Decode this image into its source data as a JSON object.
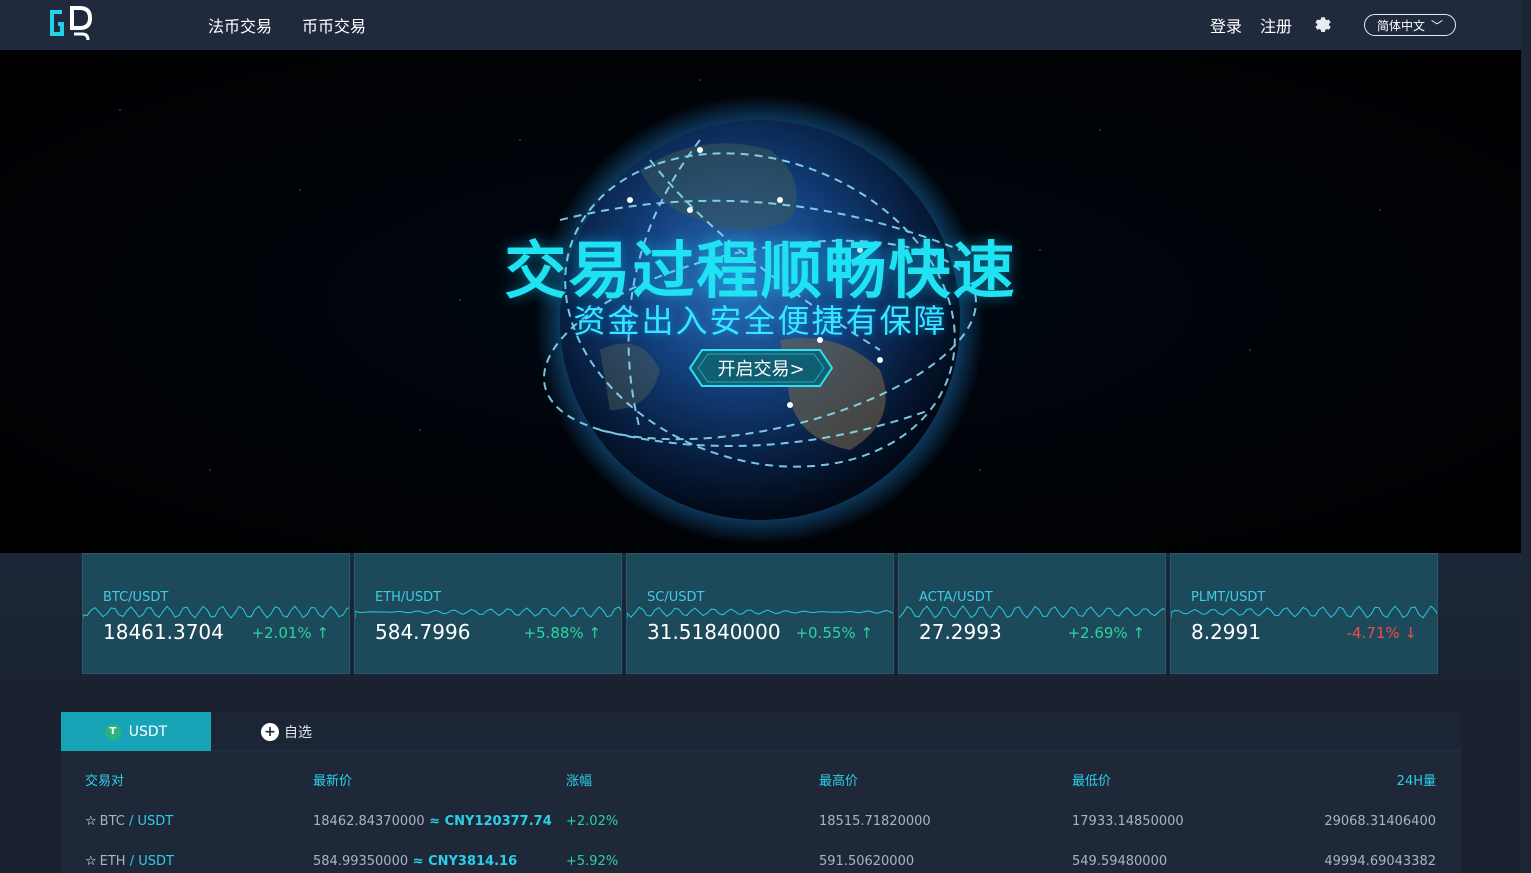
{
  "nav": {
    "logo_text": "GD",
    "links": [
      "法币交易",
      "币币交易"
    ],
    "login": "登录",
    "register": "注册",
    "language": "简体中文"
  },
  "hero": {
    "title": "交易过程顺畅快速",
    "subtitle": "资金出入安全便捷有保障",
    "button": "开启交易>"
  },
  "tickers": [
    {
      "pair": "BTC/USDT",
      "price": "18461.3704",
      "change": "+2.01% ↑",
      "direction": "up"
    },
    {
      "pair": "ETH/USDT",
      "price": "584.7996",
      "change": "+5.88% ↑",
      "direction": "up"
    },
    {
      "pair": "SC/USDT",
      "price": "31.51840000",
      "change": "+0.55% ↑",
      "direction": "up"
    },
    {
      "pair": "ACTA/USDT",
      "price": "27.2993",
      "change": "+2.69% ↑",
      "direction": "up"
    },
    {
      "pair": "PLMT/USDT",
      "price": "8.2991",
      "change": "-4.71% ↓",
      "direction": "down"
    }
  ],
  "market": {
    "tab_usdt": "USDT",
    "tab_usdt_icon": "T",
    "tab_fav": "自选",
    "headers": {
      "pair": "交易对",
      "last": "最新价",
      "change": "涨幅",
      "high": "最高价",
      "low": "最低价",
      "volume": "24H量"
    },
    "rows": [
      {
        "base": "BTC",
        "quote": "USDT",
        "last": "18462.84370000",
        "cny": "CNY120377.74",
        "change": "+2.02%",
        "high": "18515.71820000",
        "low": "17933.14850000",
        "volume": "29068.31406400"
      },
      {
        "base": "ETH",
        "quote": "USDT",
        "last": "584.99350000",
        "cny": "CNY3814.16",
        "change": "+5.92%",
        "high": "591.50620000",
        "low": "549.59480000",
        "volume": "49994.69043382"
      }
    ]
  },
  "colors": {
    "accent": "#17a4b6",
    "up": "#2ad4a0",
    "down": "#ef4b4b",
    "title_cyan": "#1fe2f2"
  }
}
